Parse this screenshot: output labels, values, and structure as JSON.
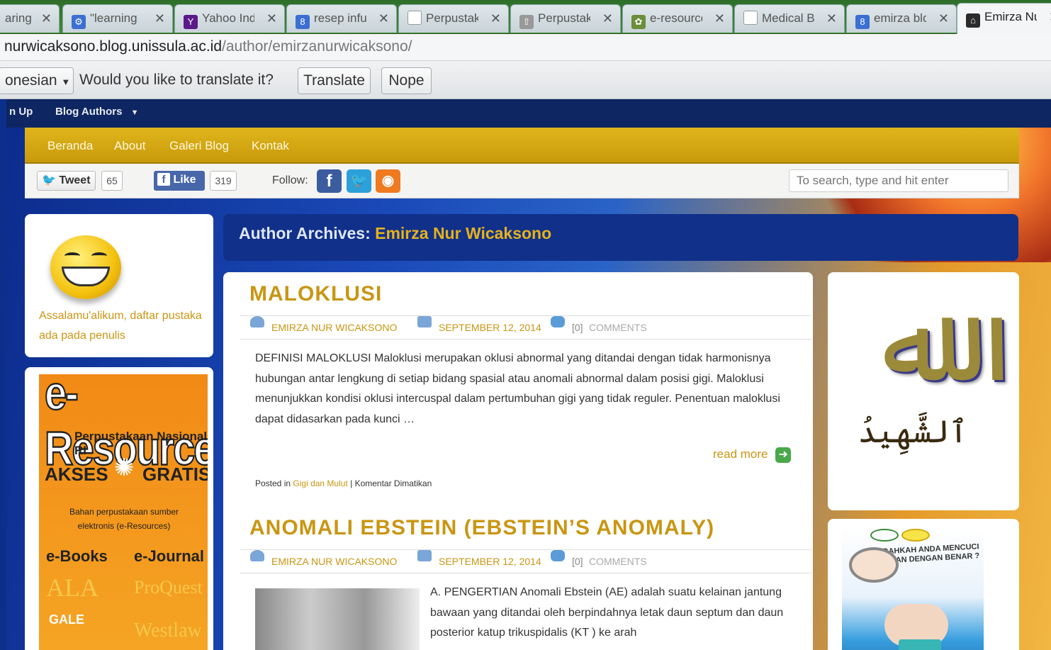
{
  "browser": {
    "tabs": [
      {
        "label": "aring",
        "icon": "page-icon",
        "fav_color": "#888888"
      },
      {
        "label": "\"learning",
        "icon": "search-icon",
        "fav_color": "#3b6fd1"
      },
      {
        "label": "Yahoo Ind",
        "icon": "yahoo-icon",
        "fav_color": "#5b1a8a"
      },
      {
        "label": "resep infu",
        "icon": "google-icon",
        "fav_color": "#3b6fd1"
      },
      {
        "label": "Perpustak",
        "icon": "page-icon",
        "fav_color": "#888888"
      },
      {
        "label": "Perpustak",
        "icon": "upload-icon",
        "fav_color": "#888888"
      },
      {
        "label": "e-resource",
        "icon": "globe-icon",
        "fav_color": "#6a8f3a"
      },
      {
        "label": "Medical B",
        "icon": "page-icon",
        "fav_color": "#888888"
      },
      {
        "label": "emirza blo",
        "icon": "google-icon",
        "fav_color": "#3b6fd1"
      },
      {
        "label": "Emirza Nu",
        "icon": "site-icon",
        "fav_color": "#2b2b2b"
      }
    ],
    "url_host": "nurwicaksono.blog.unissula.ac.id",
    "url_path": "/author/emirzanurwicaksono/"
  },
  "translate": {
    "language": "onesian",
    "question": "Would you like to translate it?",
    "translate_label": "Translate",
    "nope_label": "Nope"
  },
  "admin": {
    "signup": "n Up",
    "authors": "Blog Authors"
  },
  "nav": {
    "items": [
      "Beranda",
      "About",
      "Galeri Blog",
      "Kontak"
    ]
  },
  "social": {
    "tweet": "Tweet",
    "tweet_count": "65",
    "like": "Like",
    "like_count": "319",
    "follow": "Follow:",
    "search_placeholder": "To search, type and hit enter"
  },
  "sidebar": {
    "greeting": "Assalamu'alikum, daftar pustaka ada pada penulis",
    "banner": {
      "title": "e-Resources",
      "sub": "Perpustakaan Nasional RI",
      "akses": "AKSES",
      "gratis": "GRATIS",
      "desc": "Bahan perpustakaan sumber elektronis (e-Resources)",
      "ebooks": "e-Books",
      "ejournal": "e-Journal",
      "ala": "ALA",
      "proquest": "ProQuest",
      "gale": "GALE",
      "westlaw": "Westlaw"
    }
  },
  "archive": {
    "prefix": "Author Archives:",
    "name": "Emirza Nur Wicaksono"
  },
  "posts": [
    {
      "title": "MALOKLUSI",
      "author": "EMIRZA NUR WICAKSONO",
      "date": "SEPTEMBER 12, 2014",
      "comments": "[0]",
      "comments_label": "COMMENTS",
      "excerpt": "DEFINISI MALOKLUSI Maloklusi merupakan oklusi abnormal yang ditandai  dengan tidak harmonisnya  hubungan antar lengkung di setiap bidang spasial atau  anomali abnormal dalam posisi gigi. Maloklusi menunjukkan  kondisi oklusi  intercuspal dalam pertumbuhan gigi yang tidak reguler. Penentuan maloklusi dapat didasarkan pada kunci …",
      "read_more": "read more",
      "posted_in": "Posted in",
      "category": "Gigi dan Mulut",
      "sep": " | ",
      "comments_off": "Komentar Dimatikan"
    },
    {
      "title": "ANOMALI EBSTEIN (EBSTEIN’S ANOMALY)",
      "author": "EMIRZA NUR WICAKSONO",
      "date": "SEPTEMBER 12, 2014",
      "comments": "[0]",
      "comments_label": "COMMENTS",
      "excerpt": "A. PENGERTIAN  Anomali Ebstein (AE) adalah suatu kelainan jantung bawaan yang ditandai oleh berpindahnya letak daun septum dan daun posterior katup trikuspidalis (KT ) ke arah"
    }
  ],
  "right": {
    "arabic": "ٱلشَّهِيدُ",
    "handwash": "SUDAHKAH ANDA MENCUCI TANGAN DENGAN BENAR ?"
  }
}
